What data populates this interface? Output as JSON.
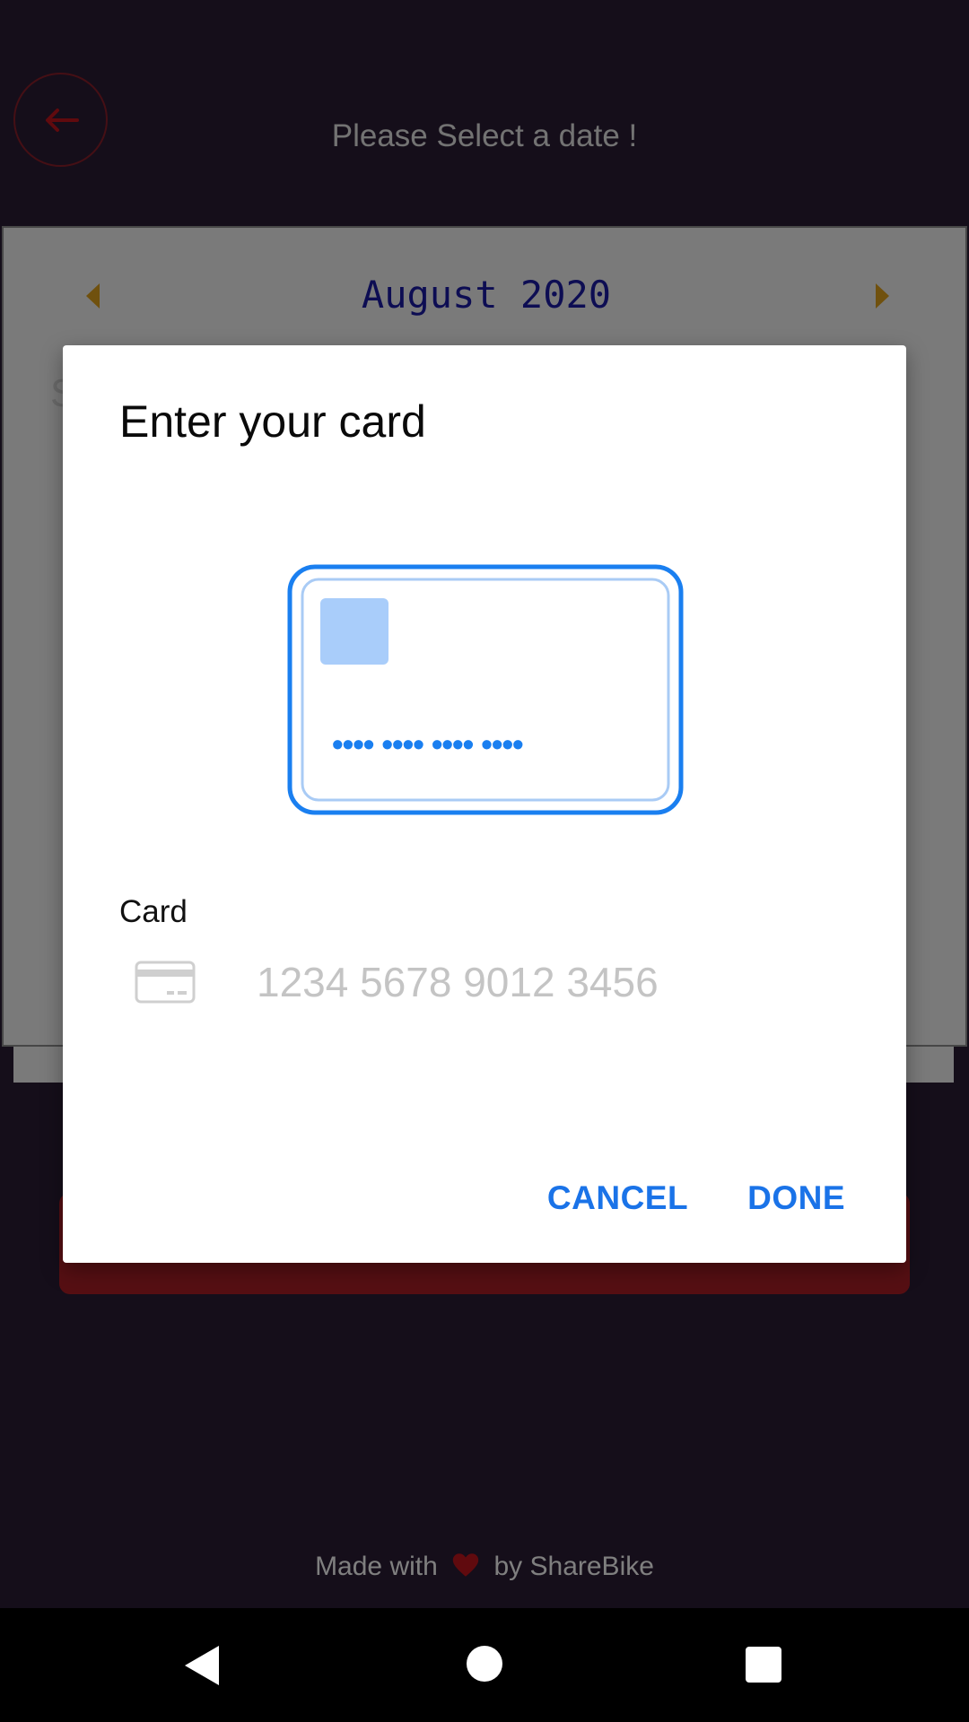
{
  "app": {
    "page_title": "Please Select a date !",
    "calendar": {
      "month_label": "August 2020",
      "edge_left": "S",
      "edge_right": "t"
    },
    "footer": {
      "prefix": "Made with",
      "suffix": "by ShareBike",
      "heart_icon": "heart-icon"
    }
  },
  "dialog": {
    "title": "Enter your card",
    "card_illustration": {
      "masked_number": "•••• •••• •••• ••••"
    },
    "card_field": {
      "label": "Card",
      "placeholder": "1234 5678 9012 3456",
      "value": "",
      "icon": "credit-card-icon"
    },
    "actions": {
      "cancel_label": "CANCEL",
      "done_label": "DONE"
    }
  },
  "colors": {
    "accent": "#1a73e8",
    "card_outline": "#1a7ff0",
    "primary_button": "#ad1e26",
    "heart": "#c0141c",
    "calendar_arrow": "#e0a21d",
    "month_text": "#1a1aa6"
  }
}
